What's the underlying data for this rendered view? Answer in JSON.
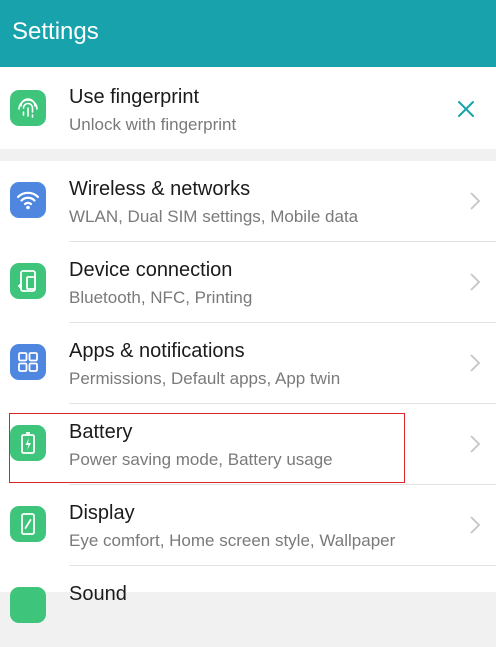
{
  "appbar": {
    "title": "Settings"
  },
  "fingerprint": {
    "title": "Use fingerprint",
    "subtitle": "Unlock with fingerprint",
    "icon": "fingerprint-icon",
    "close_icon": "close-icon"
  },
  "items": [
    {
      "title": "Wireless & networks",
      "subtitle": "WLAN, Dual SIM settings, Mobile data",
      "icon": "wifi-icon",
      "color": "#4f86e0"
    },
    {
      "title": "Device connection",
      "subtitle": "Bluetooth, NFC, Printing",
      "icon": "device-connection-icon",
      "color": "#3ec47b"
    },
    {
      "title": "Apps & notifications",
      "subtitle": "Permissions, Default apps, App twin",
      "icon": "apps-grid-icon",
      "color": "#4f86e0"
    },
    {
      "title": "Battery",
      "subtitle": "Power saving mode, Battery usage",
      "icon": "battery-icon",
      "color": "#3ec47b"
    },
    {
      "title": "Display",
      "subtitle": "Eye comfort, Home screen style, Wallpaper",
      "icon": "display-icon",
      "color": "#3ec47b"
    },
    {
      "title": "Sound",
      "subtitle": "",
      "icon": "sound-icon",
      "color": "#3ec47b"
    }
  ],
  "colors": {
    "appbar": "#18a2ac",
    "highlight": "#d7272b",
    "close": "#18a2ac"
  }
}
